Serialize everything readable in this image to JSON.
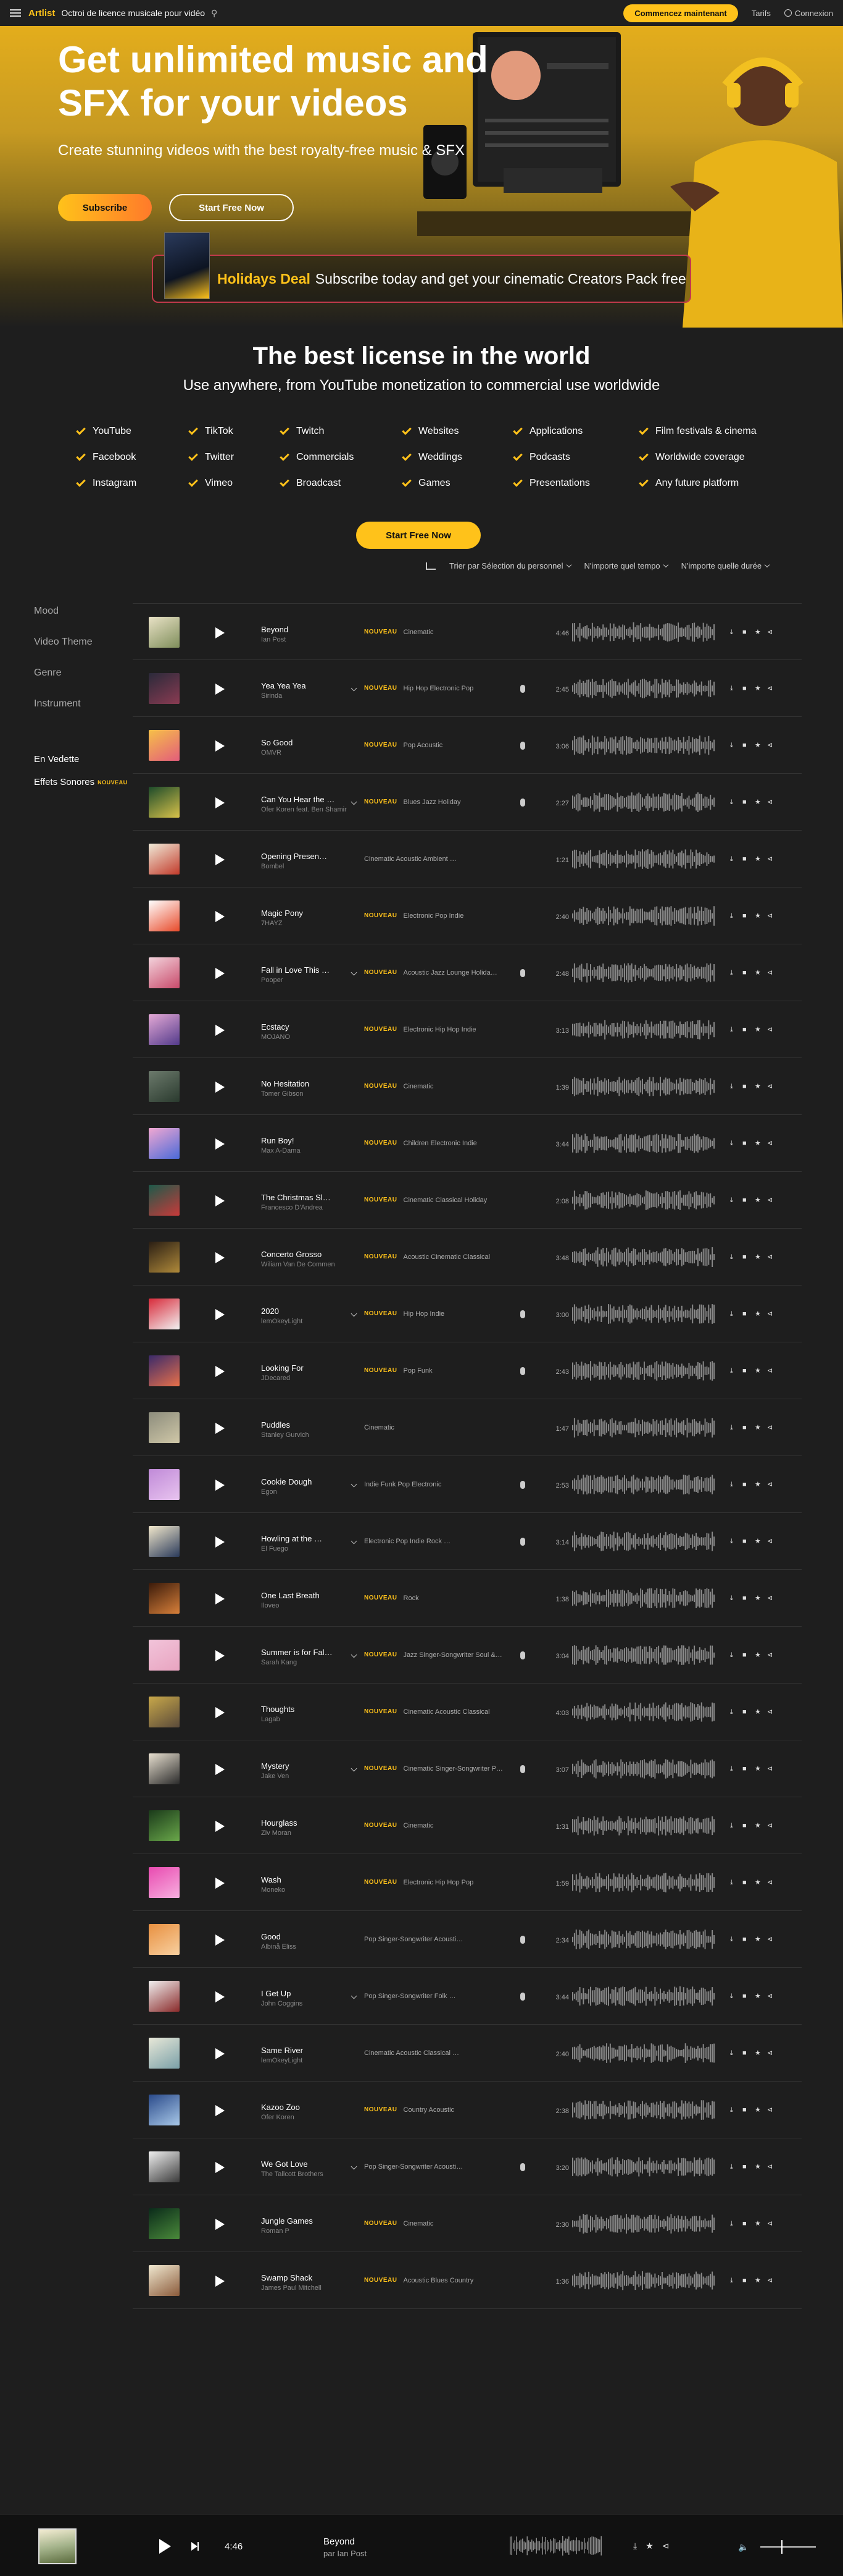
{
  "nav": {
    "logo": "Artlist",
    "tagline": "Octroi de licence musicale pour vidéo",
    "search_icon": "search-icon",
    "cta": "Commencez maintenant",
    "pricing": "Tarifs",
    "login": "Connexion"
  },
  "hero": {
    "title": "Get unlimited music and SFX for your videos",
    "subtitle": "Create stunning videos with the best royalty-free music & SFX",
    "subscribe": "Subscribe",
    "start_free": "Start Free Now"
  },
  "holiday": {
    "highlight": "Holidays Deal",
    "text": "Subscribe today and get your cinematic Creators Pack free"
  },
  "license": {
    "title": "The best license in the world",
    "subtitle": "Use anywhere, from YouTube monetization to commercial use worldwide",
    "uses": [
      "YouTube",
      "TikTok",
      "Twitch",
      "Websites",
      "Applications",
      "Film festivals & cinema",
      "Facebook",
      "Twitter",
      "Commercials",
      "Weddings",
      "Podcasts",
      "Worldwide coverage",
      "Instagram",
      "Vimeo",
      "Broadcast",
      "Games",
      "Presentations",
      "Any future platform"
    ],
    "start_free": "Start Free Now"
  },
  "filters": {
    "sort": "Trier par Sélection du personnel",
    "tempo": "N'importe quel tempo",
    "duration": "N'importe quelle durée"
  },
  "sidebar": {
    "items": [
      "Mood",
      "Video Theme",
      "Genre",
      "Instrument"
    ],
    "featured": "En Vedette",
    "sfx": "Effets Sonores",
    "new_badge": "NOUVEAU"
  },
  "new_label": "NOUVEAU",
  "tracks": [
    {
      "name": "Beyond",
      "artist": "Ian Post",
      "new": true,
      "tags": "Cinematic",
      "duration": "4:46",
      "chevron": false,
      "vocal": false,
      "colors": [
        "#e9e2c6",
        "#7f8e5b"
      ]
    },
    {
      "name": "Yea Yea Yea",
      "artist": "Sirinda",
      "new": true,
      "tags": "Hip Hop   Electronic   Pop",
      "duration": "2:45",
      "chevron": true,
      "vocal": true,
      "colors": [
        "#2a2a3a",
        "#8a3b52"
      ]
    },
    {
      "name": "So Good",
      "artist": "OMVR",
      "new": true,
      "tags": "Pop   Acoustic",
      "duration": "3:06",
      "chevron": false,
      "vocal": true,
      "colors": [
        "#f6c048",
        "#e35d7b"
      ]
    },
    {
      "name": "Can You Hear the …",
      "artist": "Ofer Koren feat. Ben Shamir",
      "new": true,
      "tags": "Blues   Jazz   Holiday",
      "duration": "2:27",
      "chevron": true,
      "vocal": true,
      "colors": [
        "#1c4a2a",
        "#d8c24a"
      ]
    },
    {
      "name": "Opening Presen…",
      "artist": "Bombel",
      "new": false,
      "tags": "Cinematic   Acoustic   Ambient   …",
      "duration": "1:21",
      "chevron": false,
      "vocal": false,
      "colors": [
        "#f0ead8",
        "#c23a2a"
      ]
    },
    {
      "name": "Magic Pony",
      "artist": "7HAYZ",
      "new": true,
      "tags": "Electronic   Pop   Indie",
      "duration": "2:40",
      "chevron": false,
      "vocal": false,
      "colors": [
        "#ffffff",
        "#e84a2a"
      ]
    },
    {
      "name": "Fall in Love This …",
      "artist": "Pooper",
      "new": true,
      "tags": "Acoustic   Jazz   Lounge   Holida…",
      "duration": "2:48",
      "chevron": true,
      "vocal": true,
      "colors": [
        "#f3d3dc",
        "#c84a6a"
      ]
    },
    {
      "name": "Ecstacy",
      "artist": "MOJANO",
      "new": true,
      "tags": "Electronic   Hip Hop   Indie",
      "duration": "3:13",
      "chevron": false,
      "vocal": false,
      "colors": [
        "#e4a9d6",
        "#523a8a"
      ]
    },
    {
      "name": "No Hesitation",
      "artist": "Tomer Gibson",
      "new": true,
      "tags": "Cinematic",
      "duration": "1:39",
      "chevron": false,
      "vocal": false,
      "colors": [
        "#6c7a6c",
        "#2a3a2e"
      ]
    },
    {
      "name": "Run Boy!",
      "artist": "Max A-Dama",
      "new": true,
      "tags": "Children   Electronic   Indie",
      "duration": "3:44",
      "chevron": false,
      "vocal": false,
      "colors": [
        "#f2a8d2",
        "#4a6ad8"
      ]
    },
    {
      "name": "The Christmas Sl…",
      "artist": "Francesco D'Andrea",
      "new": true,
      "tags": "Cinematic   Classical   Holiday",
      "duration": "2:08",
      "chevron": false,
      "vocal": false,
      "colors": [
        "#1c5a4a",
        "#c83a3a"
      ]
    },
    {
      "name": "Concerto Grosso",
      "artist": "Wiliam Van De Commen",
      "new": true,
      "tags": "Acoustic   Cinematic   Classical",
      "duration": "3:48",
      "chevron": false,
      "vocal": false,
      "colors": [
        "#2a1e14",
        "#b08a3a"
      ]
    },
    {
      "name": "2020",
      "artist": "lemOkeyLight",
      "new": true,
      "tags": "Hip Hop   Indie",
      "duration": "3:00",
      "chevron": true,
      "vocal": true,
      "colors": [
        "#d82a3a",
        "#f2f2f2"
      ]
    },
    {
      "name": "Looking For",
      "artist": "JDecared",
      "new": true,
      "tags": "Pop   Funk",
      "duration": "2:43",
      "chevron": false,
      "vocal": true,
      "colors": [
        "#3a2a6a",
        "#e8704a"
      ]
    },
    {
      "name": "Puddles",
      "artist": "Stanley Gurvich",
      "new": false,
      "tags": "Cinematic",
      "duration": "1:47",
      "chevron": false,
      "vocal": false,
      "colors": [
        "#8c8c7c",
        "#d0c8a8"
      ]
    },
    {
      "name": "Cookie Dough",
      "artist": "Egon",
      "new": false,
      "tags": "Indie   Funk   Pop   Electronic",
      "duration": "2:53",
      "chevron": true,
      "vocal": true,
      "colors": [
        "#c08ad8",
        "#e8c4ef"
      ]
    },
    {
      "name": "Howling at the …",
      "artist": "El Fuego",
      "new": false,
      "tags": "Electronic   Pop   Indie   Rock   …",
      "duration": "3:14",
      "chevron": true,
      "vocal": true,
      "colors": [
        "#f2e8cc",
        "#2a3a5a"
      ]
    },
    {
      "name": "One Last Breath",
      "artist": "Iloveo",
      "new": true,
      "tags": "Rock",
      "duration": "1:38",
      "chevron": false,
      "vocal": false,
      "colors": [
        "#3a1a0a",
        "#d8803a"
      ]
    },
    {
      "name": "Summer is for Fal…",
      "artist": "Sarah Kang",
      "new": true,
      "tags": "Jazz   Singer-Songwriter   Soul &…",
      "duration": "3:04",
      "chevron": true,
      "vocal": true,
      "colors": [
        "#f2c4da",
        "#e8a4c0"
      ]
    },
    {
      "name": "Thoughts",
      "artist": "Lagab",
      "new": true,
      "tags": "Cinematic   Acoustic   Classical",
      "duration": "4:03",
      "chevron": false,
      "vocal": false,
      "colors": [
        "#c8a84a",
        "#5a4a3a"
      ]
    },
    {
      "name": "Mystery",
      "artist": "Jake Ven",
      "new": true,
      "tags": "Cinematic   Singer-Songwriter   P…",
      "duration": "3:07",
      "chevron": true,
      "vocal": true,
      "colors": [
        "#e8e0d0",
        "#2a2a2a"
      ]
    },
    {
      "name": "Hourglass",
      "artist": "Ziv Moran",
      "new": true,
      "tags": "Cinematic",
      "duration": "1:31",
      "chevron": false,
      "vocal": false,
      "colors": [
        "#1a3a1a",
        "#6aa84a"
      ]
    },
    {
      "name": "Wash",
      "artist": "Moneko",
      "new": true,
      "tags": "Electronic   Hip Hop   Pop",
      "duration": "1:59",
      "chevron": false,
      "vocal": false,
      "colors": [
        "#e84ab0",
        "#f8b0e0"
      ]
    },
    {
      "name": "Good",
      "artist": "Albinå Eliss",
      "new": false,
      "tags": "Pop   Singer-Songwriter   Acousti…",
      "duration": "2:34",
      "chevron": false,
      "vocal": true,
      "colors": [
        "#e89040",
        "#f8d0a0"
      ]
    },
    {
      "name": "I Get Up",
      "artist": "John Coggins",
      "new": false,
      "tags": "Pop   Singer-Songwriter   Folk   …",
      "duration": "3:44",
      "chevron": true,
      "vocal": true,
      "colors": [
        "#f0f0f0",
        "#8a2a2a"
      ]
    },
    {
      "name": "Same River",
      "artist": "lemOkeyLight",
      "new": false,
      "tags": "Cinematic   Acoustic   Classical   …",
      "duration": "2:40",
      "chevron": false,
      "vocal": false,
      "colors": [
        "#e8e8d8",
        "#7aa0a8"
      ]
    },
    {
      "name": "Kazoo Zoo",
      "artist": "Ofer Koren",
      "new": true,
      "tags": "Country   Acoustic",
      "duration": "2:38",
      "chevron": false,
      "vocal": false,
      "colors": [
        "#2a4a8a",
        "#a8c8e8"
      ]
    },
    {
      "name": "We Got Love",
      "artist": "The Tallcott Brothers",
      "new": false,
      "tags": "Pop   Singer-Songwriter   Acousti…",
      "duration": "3:20",
      "chevron": true,
      "vocal": true,
      "colors": [
        "#f0f0f0",
        "#3a3a3a"
      ]
    },
    {
      "name": "Jungle Games",
      "artist": "Roman P",
      "new": true,
      "tags": "Cinematic",
      "duration": "2:30",
      "chevron": false,
      "vocal": false,
      "colors": [
        "#0a2a1a",
        "#4a8a3a"
      ]
    },
    {
      "name": "Swamp Shack",
      "artist": "James Paul Mitchell",
      "new": true,
      "tags": "Acoustic   Blues   Country",
      "duration": "1:36",
      "chevron": false,
      "vocal": false,
      "colors": [
        "#f0e8d0",
        "#8a5a3a"
      ]
    }
  ],
  "player": {
    "time": "4:46",
    "title": "Beyond",
    "artist": "par Ian Post"
  }
}
